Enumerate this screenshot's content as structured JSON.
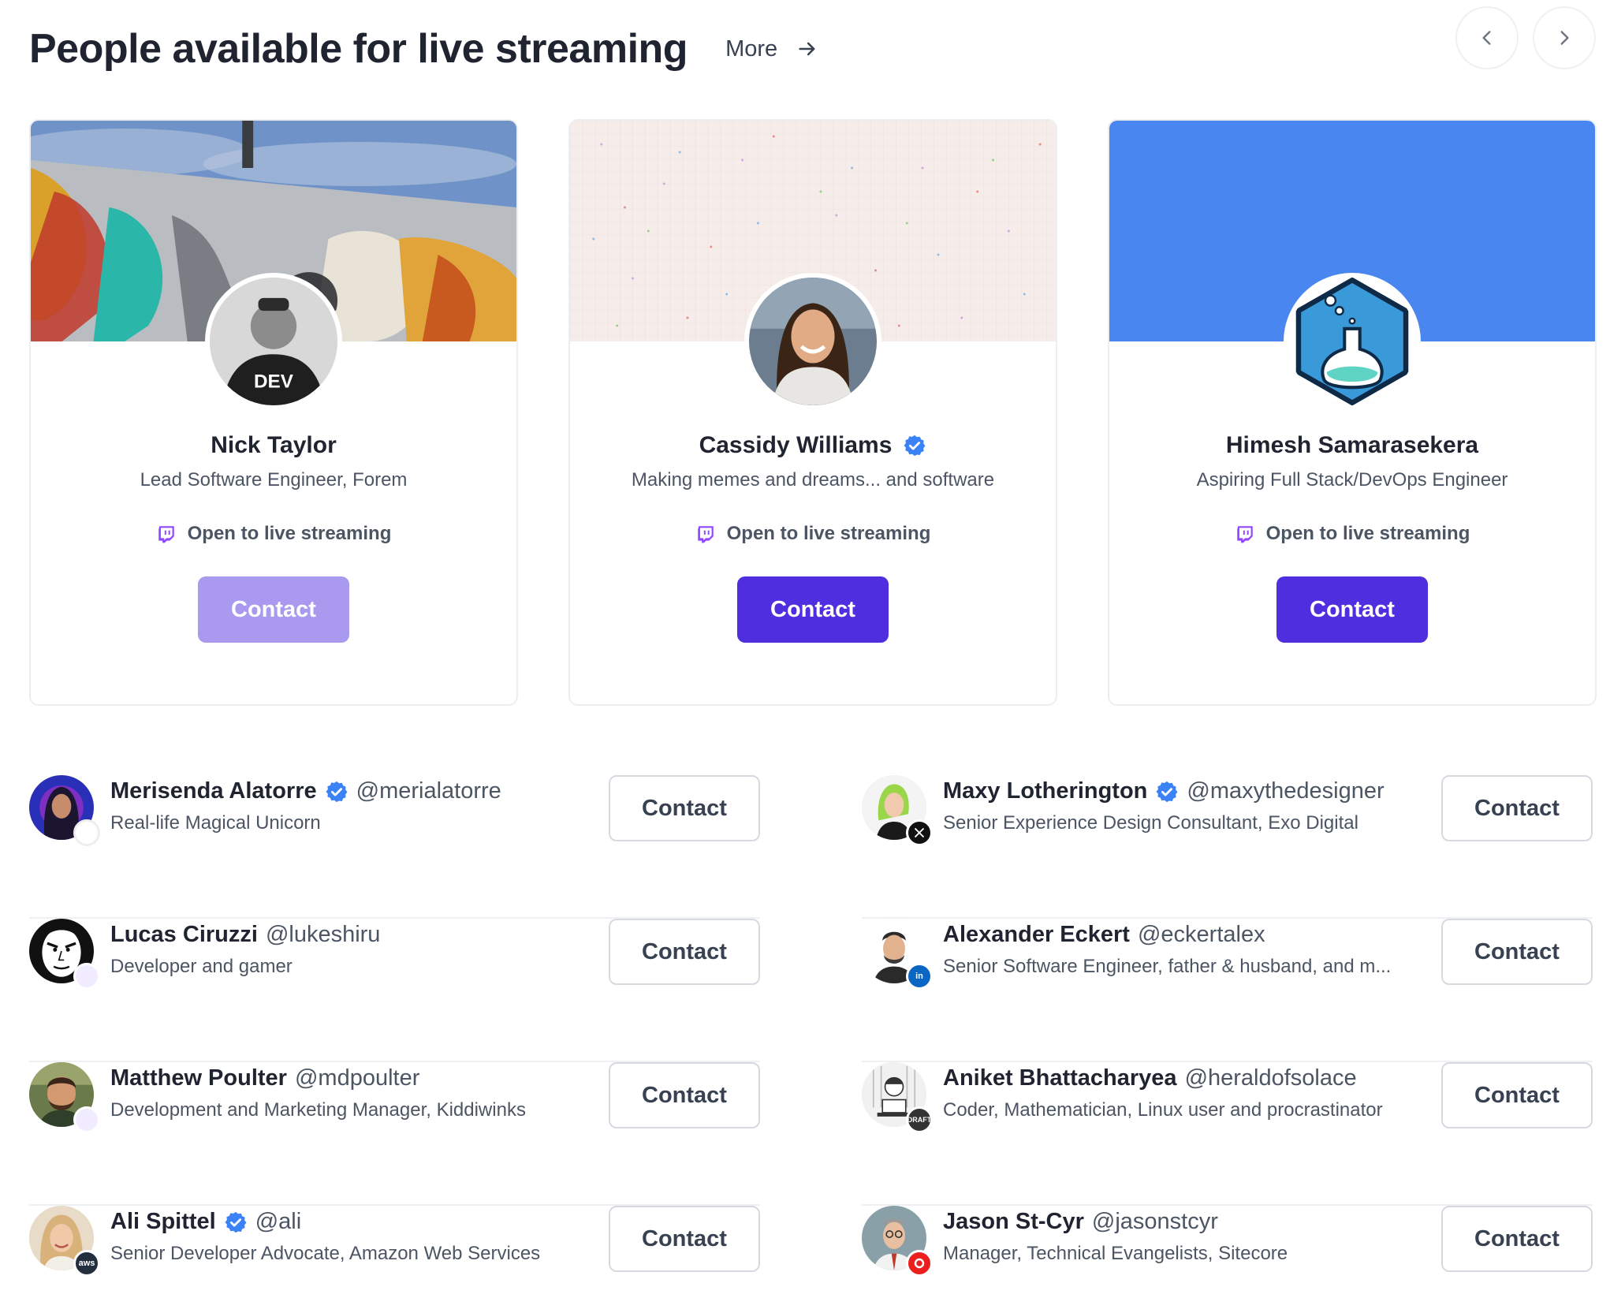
{
  "header": {
    "title": "People available for live streaming",
    "more_label": "More"
  },
  "featured": [
    {
      "name": "Nick Taylor",
      "bio": "Lead Software Engineer, Forem",
      "stream_label": "Open to live streaming",
      "contact_label": "Contact",
      "verified": false,
      "contact_disabled": true
    },
    {
      "name": "Cassidy Williams",
      "bio": "Making memes and dreams... and software",
      "stream_label": "Open to live streaming",
      "contact_label": "Contact",
      "verified": true,
      "contact_disabled": false
    },
    {
      "name": "Himesh Samarasekera",
      "bio": "Aspiring Full Stack/DevOps Engineer",
      "stream_label": "Open to live streaming",
      "contact_label": "Contact",
      "verified": false,
      "contact_disabled": false
    }
  ],
  "people_left": [
    {
      "name": "Merisenda Alatorre",
      "handle": "@merialatorre",
      "bio": "Real-life Magical Unicorn",
      "verified": true,
      "contact_label": "Contact"
    },
    {
      "name": "Lucas Ciruzzi",
      "handle": "@lukeshiru",
      "bio": "Developer and gamer",
      "verified": false,
      "contact_label": "Contact"
    },
    {
      "name": "Matthew Poulter",
      "handle": "@mdpoulter",
      "bio": "Development and Marketing Manager, Kiddiwinks",
      "verified": false,
      "contact_label": "Contact"
    },
    {
      "name": "Ali Spittel",
      "handle": "@ali",
      "bio": "Senior Developer Advocate, Amazon Web Services",
      "verified": true,
      "contact_label": "Contact",
      "badge_text": "aws"
    }
  ],
  "people_right": [
    {
      "name": "Maxy Lotherington",
      "handle": "@maxythedesigner",
      "bio": "Senior Experience Design Consultant, Exo Digital",
      "verified": true,
      "contact_label": "Contact"
    },
    {
      "name": "Alexander Eckert",
      "handle": "@eckertalex",
      "bio": "Senior Software Engineer, father & husband, and m...",
      "verified": false,
      "contact_label": "Contact",
      "badge_text": "in"
    },
    {
      "name": "Aniket Bhattacharyea",
      "handle": "@heraldofsolace",
      "bio": "Coder, Mathematician, Linux user and procrastinator",
      "verified": false,
      "contact_label": "Contact",
      "badge_text": "DRAFT"
    },
    {
      "name": "Jason St-Cyr",
      "handle": "@jasonstcyr",
      "bio": "Manager, Technical Evangelists, Sitecore",
      "verified": false,
      "contact_label": "Contact"
    }
  ],
  "colors": {
    "primary": "#4f2ee0",
    "primary_disabled": "#a99af0",
    "twitch": "#9146ff",
    "verified": "#3b82f6",
    "cover_blue": "#4a86f0"
  }
}
